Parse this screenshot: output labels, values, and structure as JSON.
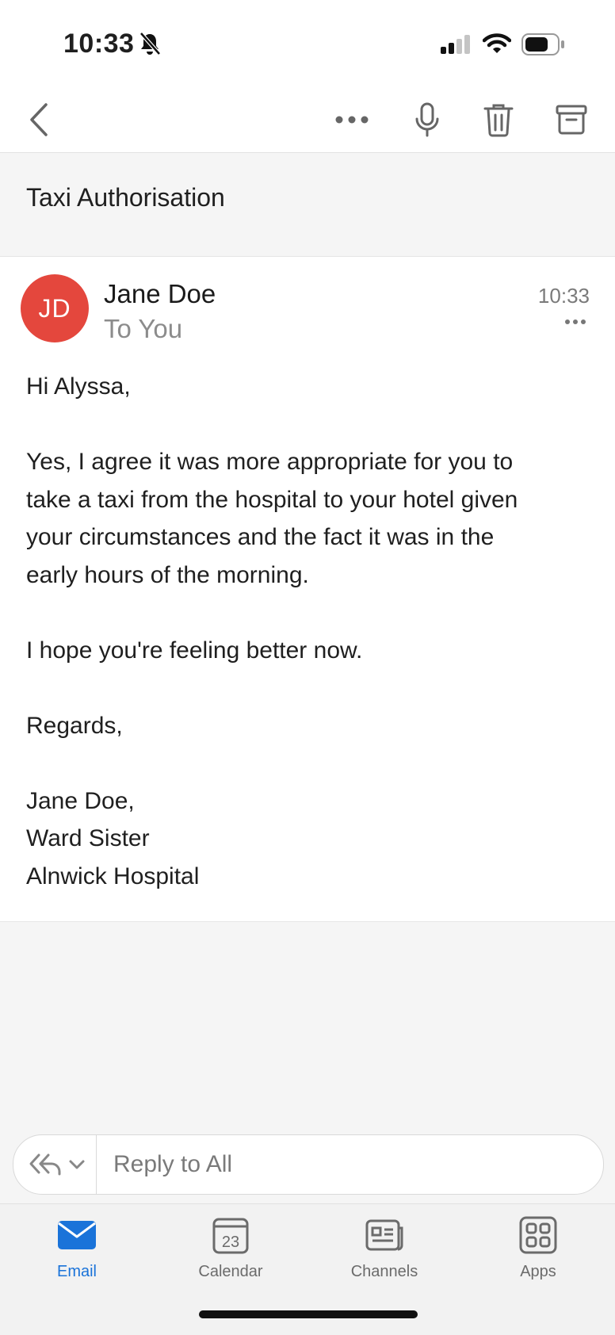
{
  "status_bar": {
    "time": "10:33"
  },
  "header": {
    "subject": "Taxi Authorisation"
  },
  "message": {
    "avatar_initials": "JD",
    "avatar_color": "#e4473d",
    "sender": "Jane Doe",
    "recipient": "To You",
    "time": "10:33",
    "body": {
      "greeting": "Hi Alyssa,",
      "para1_line1": "Yes, I agree it was more appropriate for you to",
      "para1_line2": "take a taxi from the hospital to your hotel given",
      "para1_line3": "your circumstances and the fact it was in the",
      "para1_line4": "early hours of the morning.",
      "para2": "I hope you're feeling better now.",
      "closing": "Regards,",
      "sig_name": "Jane Doe,",
      "sig_title": "Ward Sister",
      "sig_org": "Alnwick Hospital"
    }
  },
  "reply": {
    "placeholder": "Reply to All"
  },
  "tabs": [
    {
      "label": "Email",
      "active": true
    },
    {
      "label": "Calendar",
      "day": "23"
    },
    {
      "label": "Channels"
    },
    {
      "label": "Apps"
    }
  ],
  "colors": {
    "accent": "#1a73d9"
  }
}
